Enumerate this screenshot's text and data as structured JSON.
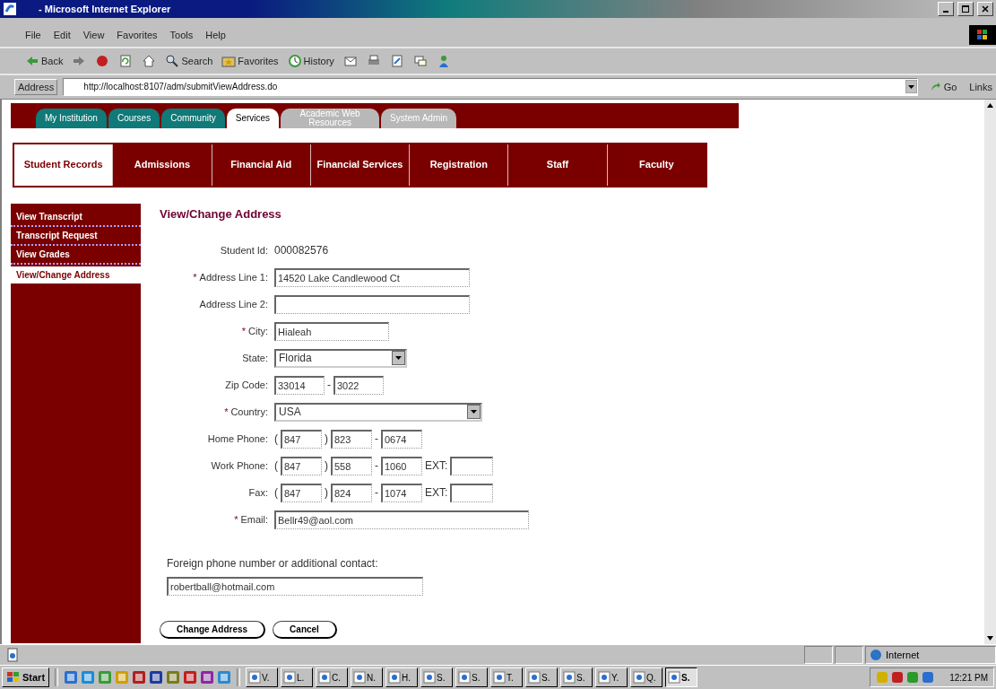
{
  "window": {
    "title": "- Microsoft Internet Explorer"
  },
  "menu": [
    "File",
    "Edit",
    "View",
    "Favorites",
    "Tools",
    "Help"
  ],
  "toolbar": [
    {
      "kind": "back",
      "label": "Back"
    },
    {
      "kind": "forward"
    },
    {
      "kind": "stop"
    },
    {
      "kind": "refresh"
    },
    {
      "kind": "home"
    },
    {
      "kind": "search",
      "label": "Search"
    },
    {
      "kind": "favorites",
      "label": "Favorites"
    },
    {
      "kind": "history",
      "label": "History"
    },
    {
      "kind": "mail"
    },
    {
      "kind": "print"
    },
    {
      "kind": "edit"
    },
    {
      "kind": "discuss"
    },
    {
      "kind": "messenger"
    }
  ],
  "address": {
    "label": "Address",
    "url": "http://localhost:8107/adm/submitViewAddress.do",
    "go": "Go",
    "links": "Links"
  },
  "portal_tabs": [
    {
      "label": "My Institution",
      "color": "#0f7a78",
      "selected": false
    },
    {
      "label": "Courses",
      "color": "#0f7a78",
      "selected": false
    },
    {
      "label": "Community",
      "color": "#0f7a78",
      "selected": false
    },
    {
      "label": "Services",
      "color": "#ffffff",
      "selected": true
    },
    {
      "label": "Academic Web Resources",
      "color": "#b8b8b8",
      "selected": false
    },
    {
      "label": "System Admin",
      "color": "#b8b8b8",
      "selected": false
    }
  ],
  "nav": [
    {
      "label": "Student Records",
      "selected": true
    },
    {
      "label": "Admissions",
      "selected": false
    },
    {
      "label": "Financial Aid",
      "selected": false
    },
    {
      "label": "Financial Services",
      "selected": false
    },
    {
      "label": "Registration",
      "selected": false
    },
    {
      "label": "Staff",
      "selected": false
    },
    {
      "label": "Faculty",
      "selected": false
    }
  ],
  "sidebar": [
    {
      "label": "View Transcript",
      "selected": false
    },
    {
      "label": "Transcript Request",
      "selected": false
    },
    {
      "label": "View Grades",
      "selected": false
    },
    {
      "label": "View/Change Address",
      "selected": true
    }
  ],
  "form": {
    "title": "View/Change Address",
    "rows": [
      {
        "label": "Student Id:",
        "parts": [
          {
            "kind": "value",
            "text": "000082576"
          }
        ]
      },
      {
        "mark": "*",
        "label": "Address Line 1:",
        "parts": [
          {
            "kind": "wide",
            "value": "14520 Lake Candlewood Ct"
          }
        ]
      },
      {
        "label": "Address Line 2:",
        "parts": [
          {
            "kind": "wide"
          }
        ]
      },
      {
        "mark": "*",
        "label": "City:",
        "parts": [
          {
            "kind": "mid",
            "value": "Hialeah"
          }
        ]
      },
      {
        "label": "State:",
        "parts": [
          {
            "kind": "select",
            "value": "Florida"
          }
        ]
      },
      {
        "label": "Zip Code:",
        "parts": [
          {
            "kind": "zip",
            "value": "33014"
          },
          {
            "kind": "sep",
            "text": "-"
          },
          {
            "kind": "zip",
            "value": "3022"
          }
        ]
      },
      {
        "mark": "*",
        "label": "Country:",
        "parts": [
          {
            "kind": "selectwide",
            "value": "USA"
          }
        ]
      },
      {
        "label": "Home Phone:",
        "parts": [
          {
            "kind": "sep",
            "text": "("
          },
          {
            "kind": "phone",
            "value": "847"
          },
          {
            "kind": "sep",
            "text": ")"
          },
          {
            "kind": "phone",
            "value": "823"
          },
          {
            "kind": "sep",
            "text": "-"
          },
          {
            "kind": "phone",
            "value": "0674"
          }
        ]
      },
      {
        "label": "Work Phone:",
        "parts": [
          {
            "kind": "sep",
            "text": "("
          },
          {
            "kind": "phone",
            "value": "847"
          },
          {
            "kind": "sep",
            "text": ")"
          },
          {
            "kind": "phone",
            "value": "558"
          },
          {
            "kind": "sep",
            "text": "-"
          },
          {
            "kind": "phone",
            "value": "1060"
          },
          {
            "kind": "sep",
            "text": "EXT:"
          },
          {
            "kind": "ext"
          }
        ]
      },
      {
        "label": "Fax:",
        "parts": [
          {
            "kind": "sep",
            "text": "("
          },
          {
            "kind": "phone",
            "value": "847"
          },
          {
            "kind": "sep",
            "text": ")"
          },
          {
            "kind": "phone",
            "value": "824"
          },
          {
            "kind": "sep",
            "text": "-"
          },
          {
            "kind": "phone",
            "value": "1074"
          },
          {
            "kind": "sep",
            "text": "EXT:"
          },
          {
            "kind": "ext"
          }
        ]
      },
      {
        "mark": "*",
        "label": "Email:",
        "parts": [
          {
            "kind": "email",
            "value": "Bellr49@aol.com"
          }
        ]
      }
    ],
    "foreign": {
      "label": "Foreign phone number or additional contact:",
      "value": "robertball@hotmail.com"
    },
    "buttons": [
      "Change Address",
      "Cancel"
    ]
  },
  "status_bar": {
    "zone": "Internet"
  },
  "taskbar": {
    "start": "Start",
    "tasks": [
      {
        "label": "V.",
        "selected": false
      },
      {
        "label": "L.",
        "selected": false
      },
      {
        "label": "C.",
        "selected": false
      },
      {
        "label": "N.",
        "selected": false
      },
      {
        "label": "H.",
        "selected": false
      },
      {
        "label": "S.",
        "selected": false
      },
      {
        "label": "S.",
        "selected": false
      },
      {
        "label": "T.",
        "selected": false
      },
      {
        "label": "S.",
        "selected": false
      },
      {
        "label": "S.",
        "selected": false
      },
      {
        "label": "Y.",
        "selected": false
      },
      {
        "label": "Q.",
        "selected": false
      },
      {
        "label": "S.",
        "selected": true
      }
    ],
    "time": "12:21 PM"
  }
}
